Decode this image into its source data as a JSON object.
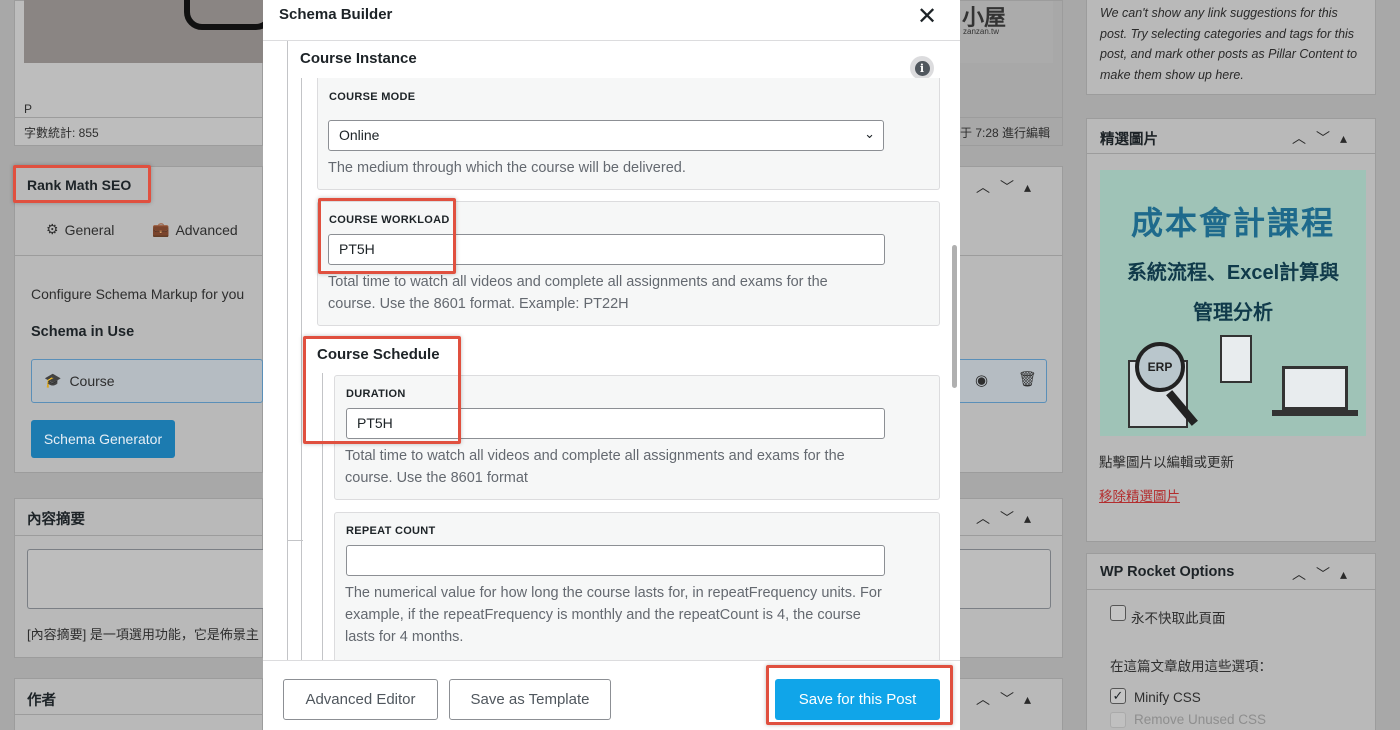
{
  "left": {
    "paragraph_tag": "P",
    "word_count": "字數統計: 855",
    "rank_math_title": "Rank Math SEO",
    "tab_general": "General",
    "tab_advanced": "Advanced",
    "configure_text": "Configure Schema Markup for you",
    "schema_in_use": "Schema in Use",
    "schema_course": "Course",
    "schema_generator": "Schema Generator",
    "excerpt_title": "內容摘要",
    "excerpt_note": "[內容摘要] 是一項選用功能，它是佈景主",
    "author_title": "作者",
    "edit_time": "于 7:28 進行編輯"
  },
  "right": {
    "pillar_note": "We can't show any link suggestions for this post. Try selecting categories and tags for this post, and mark other posts as Pillar Content to make them show up here.",
    "featured_title": "精選圖片",
    "featured_img_line1": "成本會計課程",
    "featured_img_line2": "系統流程、Excel計算與",
    "featured_img_line3": "管理分析",
    "featured_img_badge": "ERP",
    "featured_click": "點擊圖片以編輯或更新",
    "featured_remove": "移除精選圖片",
    "wprocket_title": "WP Rocket Options",
    "never_cache": "永不快取此頁面",
    "enable_options": "在這篇文章啟用這些選項：",
    "minify_css": "Minify CSS",
    "remove_unused": "Remove Unused CSS"
  },
  "top_image_watermark": "小屋",
  "top_image_watermark_sub": "zanzan.tw",
  "modal": {
    "title": "Schema Builder",
    "course_instance": "Course Instance",
    "course_mode_label": "COURSE MODE",
    "course_mode_value": "Online",
    "course_mode_desc": "The medium through which the course will be delivered.",
    "workload_label": "COURSE WORKLOAD",
    "workload_value": "PT5H",
    "workload_desc": "Total time to watch all videos and complete all assignments and exams for the course. Use the 8601 format. Example: PT22H",
    "course_schedule": "Course Schedule",
    "duration_label": "DURATION",
    "duration_value": "PT5H",
    "duration_desc": "Total time to watch all videos and complete all assignments and exams for the course. Use the 8601 format",
    "repeat_label": "REPEAT COUNT",
    "repeat_value": "",
    "repeat_desc": "The numerical value for how long the course lasts for, in repeatFrequency units. For example, if the repeatFrequency is monthly and the repeatCount is 4, the course lasts for 4 months.",
    "btn_advanced_editor": "Advanced Editor",
    "btn_save_template": "Save as Template",
    "btn_save_post": "Save for this Post"
  },
  "colors": {
    "primary": "#10a5e9",
    "highlight": "#e0503f",
    "link_red": "#b32d2e"
  }
}
